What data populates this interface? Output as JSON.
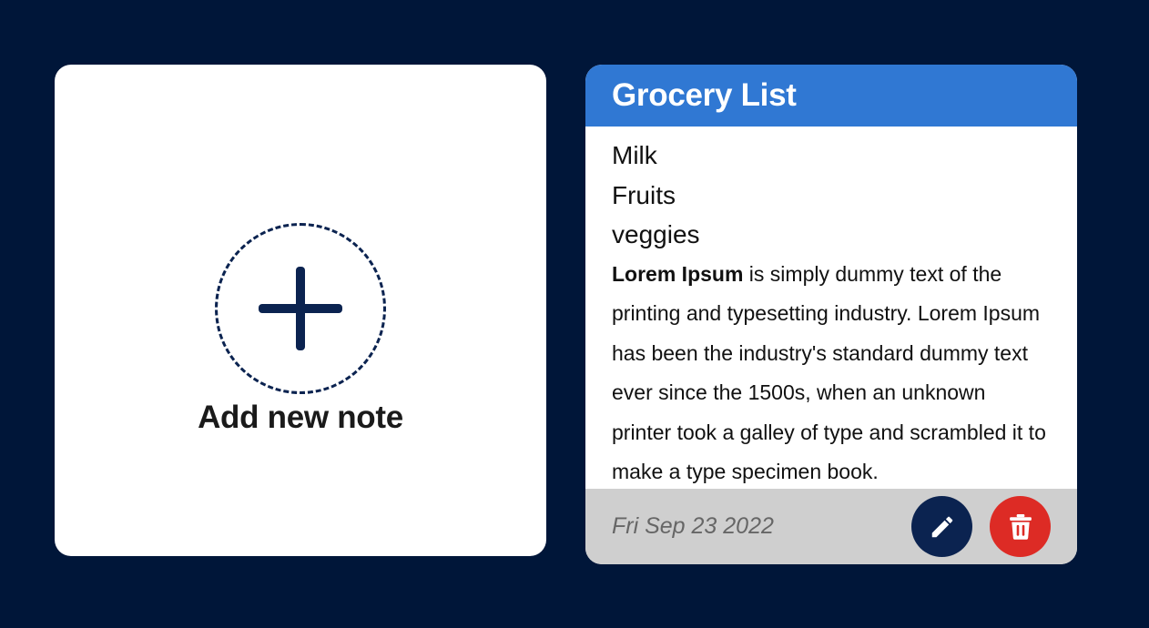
{
  "add_note": {
    "label": "Add new note",
    "icon": "plus-icon"
  },
  "note": {
    "title": "Grocery List",
    "list_items": [
      "Milk",
      "Fruits",
      "veggies"
    ],
    "paragraph_bold": "Lorem Ipsum",
    "paragraph_rest": " is simply dummy text of the printing and typesetting industry. Lorem Ipsum has been the industry's standard dummy text ever since the 1500s, when an unknown printer took a galley of type and scrambled it to make a type specimen book.",
    "date": "Fri Sep 23 2022",
    "edit_icon": "pencil-icon",
    "delete_icon": "trash-icon"
  },
  "colors": {
    "background": "#001639",
    "header": "#3078d3",
    "footer": "#cfcfcf",
    "edit_button": "#0b2350",
    "delete_button": "#dd2b25"
  }
}
